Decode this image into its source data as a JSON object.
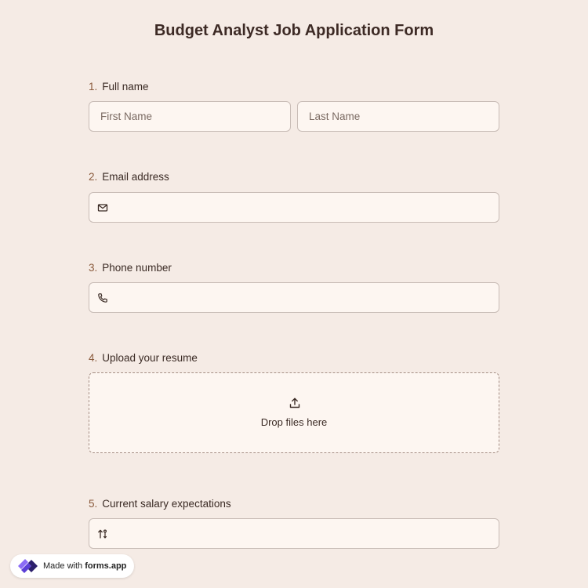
{
  "form": {
    "title": "Budget Analyst Job Application Form",
    "questions": [
      {
        "number": "1.",
        "label": "Full name",
        "fields": [
          {
            "placeholder": "First Name"
          },
          {
            "placeholder": "Last Name"
          }
        ]
      },
      {
        "number": "2.",
        "label": "Email address",
        "icon": "envelope-icon"
      },
      {
        "number": "3.",
        "label": "Phone number",
        "icon": "phone-icon"
      },
      {
        "number": "4.",
        "label": "Upload your resume",
        "icon": "upload-icon",
        "drop_text": "Drop files here"
      },
      {
        "number": "5.",
        "label": "Current salary expectations",
        "icon": "sort-icon"
      }
    ]
  },
  "badge": {
    "prefix": "Made with ",
    "brand": "forms.app"
  },
  "colors": {
    "background": "#f5ebe5",
    "field_bg": "#fdf6f1",
    "number": "#8a5a3c",
    "text": "#3a2a24"
  }
}
